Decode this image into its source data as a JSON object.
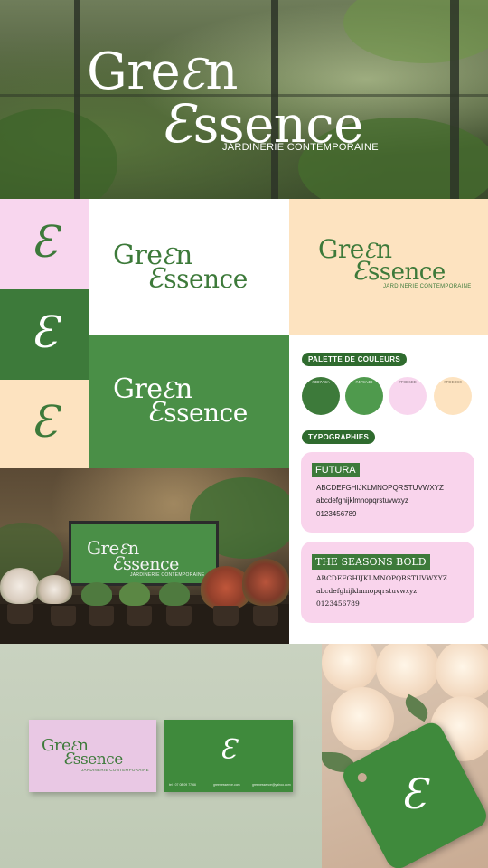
{
  "brand": {
    "name_line1": "Gre",
    "name_n": "n",
    "name_line2": "ssence",
    "monogram": "Ɛ",
    "tagline": "JARDINERIE CONTEMPORAINE"
  },
  "colors": {
    "dark_green": "#3d7a3a",
    "mid_green": "#4f9a4d",
    "pink": "#f8d6ee",
    "peach": "#fde3c0",
    "white": "#ffffff"
  },
  "palette": {
    "heading": "PALETTE DE COULEURS",
    "swatches": [
      {
        "label": "#3D7A3A",
        "color": "#3d7a3a"
      },
      {
        "label": "#4F9A4D",
        "color": "#4f9a4d"
      },
      {
        "label": "#F8D6EE",
        "color": "#f8d6ee"
      },
      {
        "label": "#FDE3C0",
        "color": "#fde3c0"
      }
    ]
  },
  "typography": {
    "heading": "TYPOGRAPHIES",
    "fonts": [
      {
        "name": "FUTURA",
        "upper": "ABCDEFGHIJKLMNOPQRSTUVWXYZ",
        "lower": "abcdefghijklmnopqrstuvwxyz",
        "digits": "0123456789"
      },
      {
        "name": "THE SEASONS BOLD",
        "upper": "ABCDEFGHIJKLMNOPQRSTUVWXYZ",
        "lower": "abcdefghijklmnopqrstuvwxyz",
        "digits": "0123456789"
      }
    ]
  },
  "business_card": {
    "footer_left": "tel : 07 08 09 77 66",
    "footer_mid": "greenessence.com",
    "footer_right": "greenessence@yahoo.com"
  }
}
